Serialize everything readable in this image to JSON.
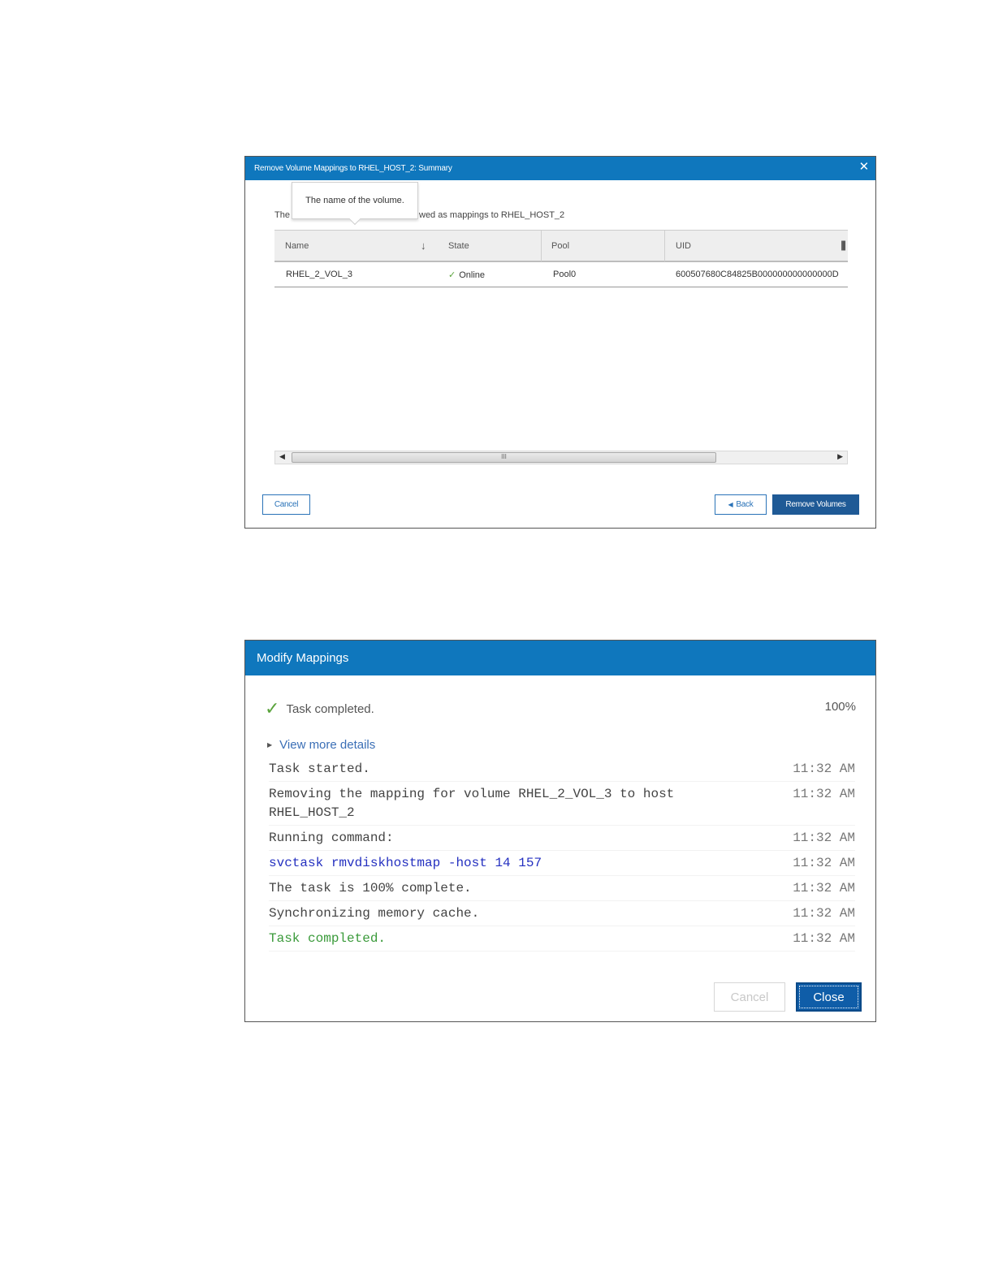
{
  "dialog1": {
    "title": "Remove Volume Mappings to RHEL_HOST_2: Summary",
    "close_glyph": "✕",
    "intro_left": "The",
    "intro_right": "wed as mappings to RHEL_HOST_2",
    "tooltip": "The name of the volume.",
    "columns": [
      "Name",
      "State",
      "Pool",
      "UID"
    ],
    "sort_glyph": "↓",
    "rows": [
      {
        "name": "RHEL_2_VOL_3",
        "state": "Online",
        "pool": "Pool0",
        "uid": "600507680C84825B000000000000000D"
      }
    ],
    "scroll_grip": "III",
    "buttons": {
      "cancel": "Cancel",
      "back": "Back",
      "remove": "Remove Volumes"
    }
  },
  "dialog2": {
    "title": "Modify Mappings",
    "status": "Task completed.",
    "percent": "100%",
    "details_link": "View more details",
    "log": [
      {
        "msg": "Task started.",
        "time": "11:32 AM",
        "kind": "normal"
      },
      {
        "msg": "Removing the mapping for volume RHEL_2_VOL_3 to host RHEL_HOST_2",
        "time": "11:32 AM",
        "kind": "normal"
      },
      {
        "msg": "Running command:",
        "time": "11:32 AM",
        "kind": "normal"
      },
      {
        "msg": "svctask rmvdiskhostmap -host 14 157",
        "time": "11:32 AM",
        "kind": "cmd"
      },
      {
        "msg": "The task is 100% complete.",
        "time": "11:32 AM",
        "kind": "normal"
      },
      {
        "msg": "Synchronizing memory cache.",
        "time": "11:32 AM",
        "kind": "normal"
      },
      {
        "msg": "Task completed.",
        "time": "11:32 AM",
        "kind": "done"
      }
    ],
    "buttons": {
      "cancel": "Cancel",
      "close": "Close"
    }
  },
  "colors": {
    "titlebar": "#0f77bd",
    "success": "#5aa33c",
    "command": "#2430c0",
    "primary_button": "#1f5a96"
  }
}
